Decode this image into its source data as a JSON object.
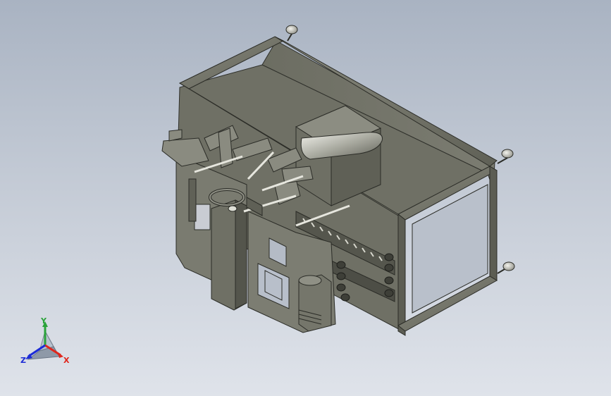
{
  "viewport": {
    "background_top": "#a9b3c2",
    "background_bottom": "#dfe3ea",
    "model_color": "#74756a"
  },
  "triad": {
    "x_label": "X",
    "y_label": "Y",
    "z_label": "Z",
    "x_color": "#e0261c",
    "y_color": "#2aa33a",
    "z_color": "#1c2bd6"
  }
}
